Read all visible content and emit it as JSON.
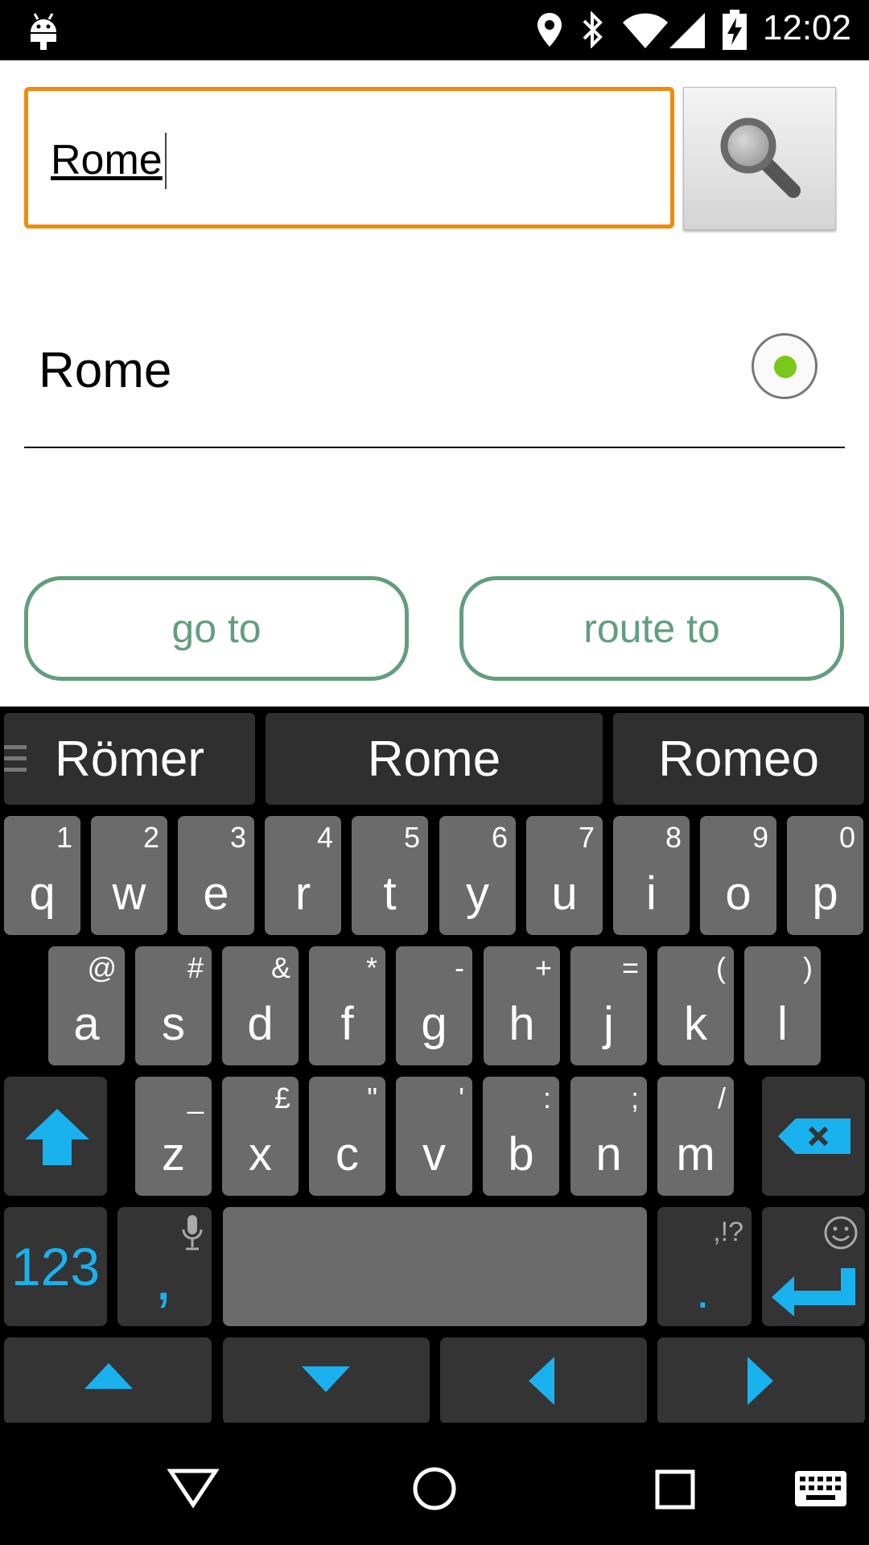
{
  "status_bar": {
    "time": "12:02"
  },
  "search": {
    "value": "Rome"
  },
  "result": {
    "label": "Rome",
    "selected": true
  },
  "actions": {
    "go_to": "go to",
    "route_to": "route to"
  },
  "suggestions": [
    "Römer",
    "Rome",
    "Romeo"
  ],
  "keyboard": {
    "row1": [
      {
        "key": "q",
        "hint": "1"
      },
      {
        "key": "w",
        "hint": "2"
      },
      {
        "key": "e",
        "hint": "3"
      },
      {
        "key": "r",
        "hint": "4"
      },
      {
        "key": "t",
        "hint": "5"
      },
      {
        "key": "y",
        "hint": "6"
      },
      {
        "key": "u",
        "hint": "7"
      },
      {
        "key": "i",
        "hint": "8"
      },
      {
        "key": "o",
        "hint": "9"
      },
      {
        "key": "p",
        "hint": "0"
      }
    ],
    "row2": [
      {
        "key": "a",
        "hint": "@"
      },
      {
        "key": "s",
        "hint": "#"
      },
      {
        "key": "d",
        "hint": "&"
      },
      {
        "key": "f",
        "hint": "*"
      },
      {
        "key": "g",
        "hint": "-"
      },
      {
        "key": "h",
        "hint": "+"
      },
      {
        "key": "j",
        "hint": "="
      },
      {
        "key": "k",
        "hint": "("
      },
      {
        "key": "l",
        "hint": ")"
      }
    ],
    "row3": [
      {
        "key": "z",
        "hint": "_"
      },
      {
        "key": "x",
        "hint": "£"
      },
      {
        "key": "c",
        "hint": "\""
      },
      {
        "key": "v",
        "hint": "'"
      },
      {
        "key": "b",
        "hint": ":"
      },
      {
        "key": "n",
        "hint": ";"
      },
      {
        "key": "m",
        "hint": "/"
      }
    ],
    "numbers_label": "123",
    "comma_label": ",",
    "period_label": ".",
    "period_hint": ",!?"
  },
  "colors": {
    "accent_orange": "#f28a0c",
    "button_green": "#629e7e",
    "key_blue": "#1ab1ef",
    "radio_green": "#7ac81a"
  }
}
